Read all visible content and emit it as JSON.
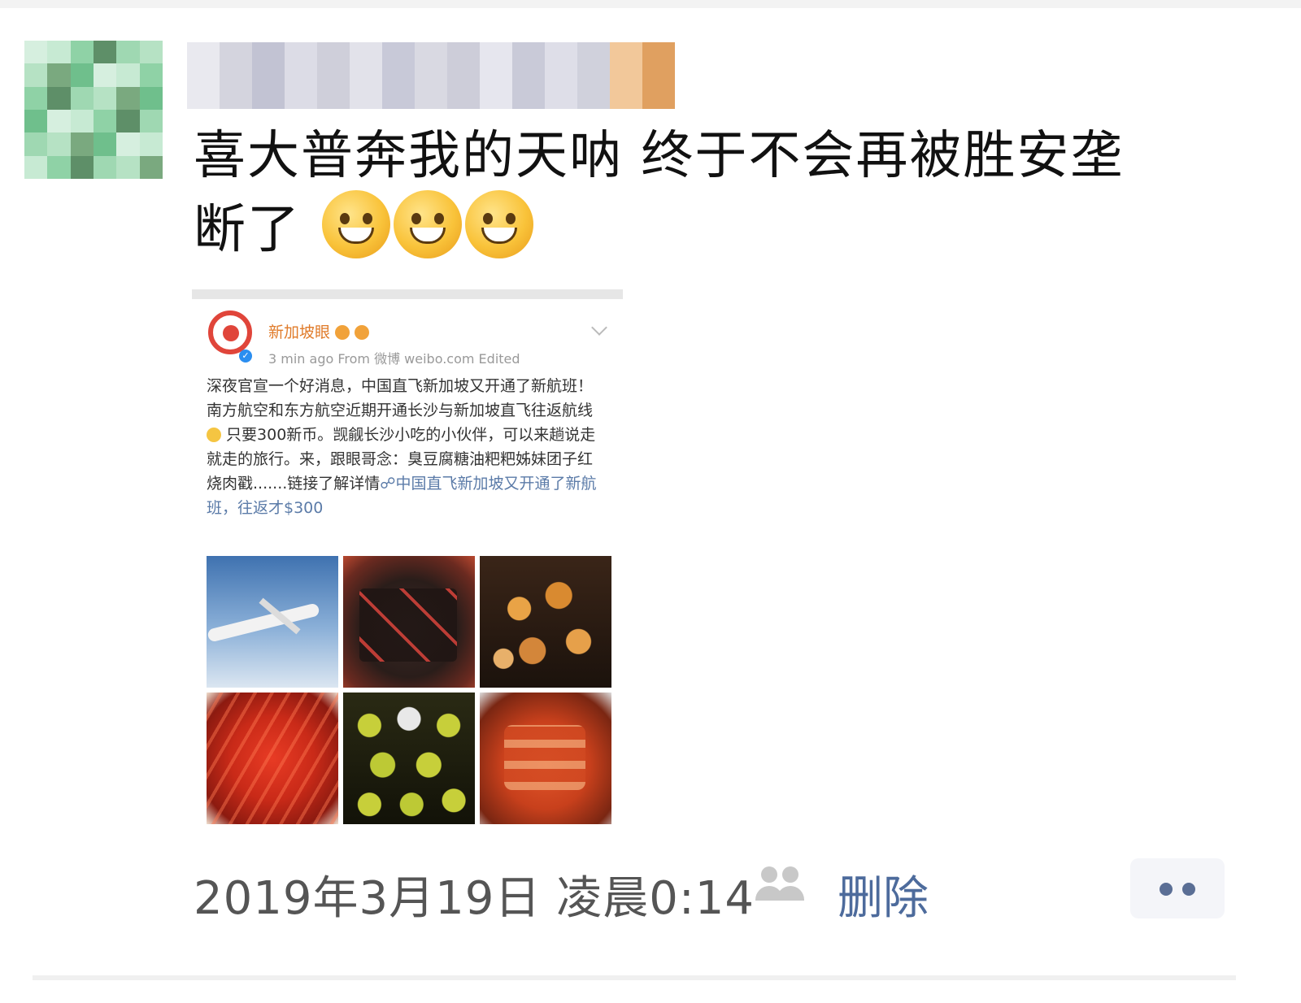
{
  "post": {
    "text_line1": "喜大普奔我的天呐 终于不会再被胜安垄",
    "text_line2": "断了",
    "emoji_count": 3
  },
  "shared_weibo": {
    "account_name": "新加坡眼",
    "meta": "3 min ago  From 微博 weibo.com  Edited",
    "body_part1": "深夜官宣一个好消息，中国直飞新加坡又开通了新航班！南方航空和东方航空近期开通长沙与新加坡直飞往返航线",
    "body_part2": " 只要300新币。觊觎长沙小吃的小伙伴，可以来趟说走就走的旅行。来，跟眼哥念：臭豆腐糖油粑粑姊妹团子红烧肉戳.......链接了解详情",
    "link_text": "☍中国直飞新加坡又开通了新航班，往返才$300",
    "images": [
      "airplane",
      "stinky-tofu",
      "fried-dough-balls",
      "crayfish",
      "dumplings",
      "braised-pork"
    ]
  },
  "footer": {
    "timestamp": "2019年3月19日 凌晨0:14",
    "delete_label": "删除",
    "more_label": "••"
  },
  "colors": {
    "name_orange": "#e07b2a",
    "link_blue": "#4d6b9c",
    "weibo_red": "#e0453a"
  }
}
